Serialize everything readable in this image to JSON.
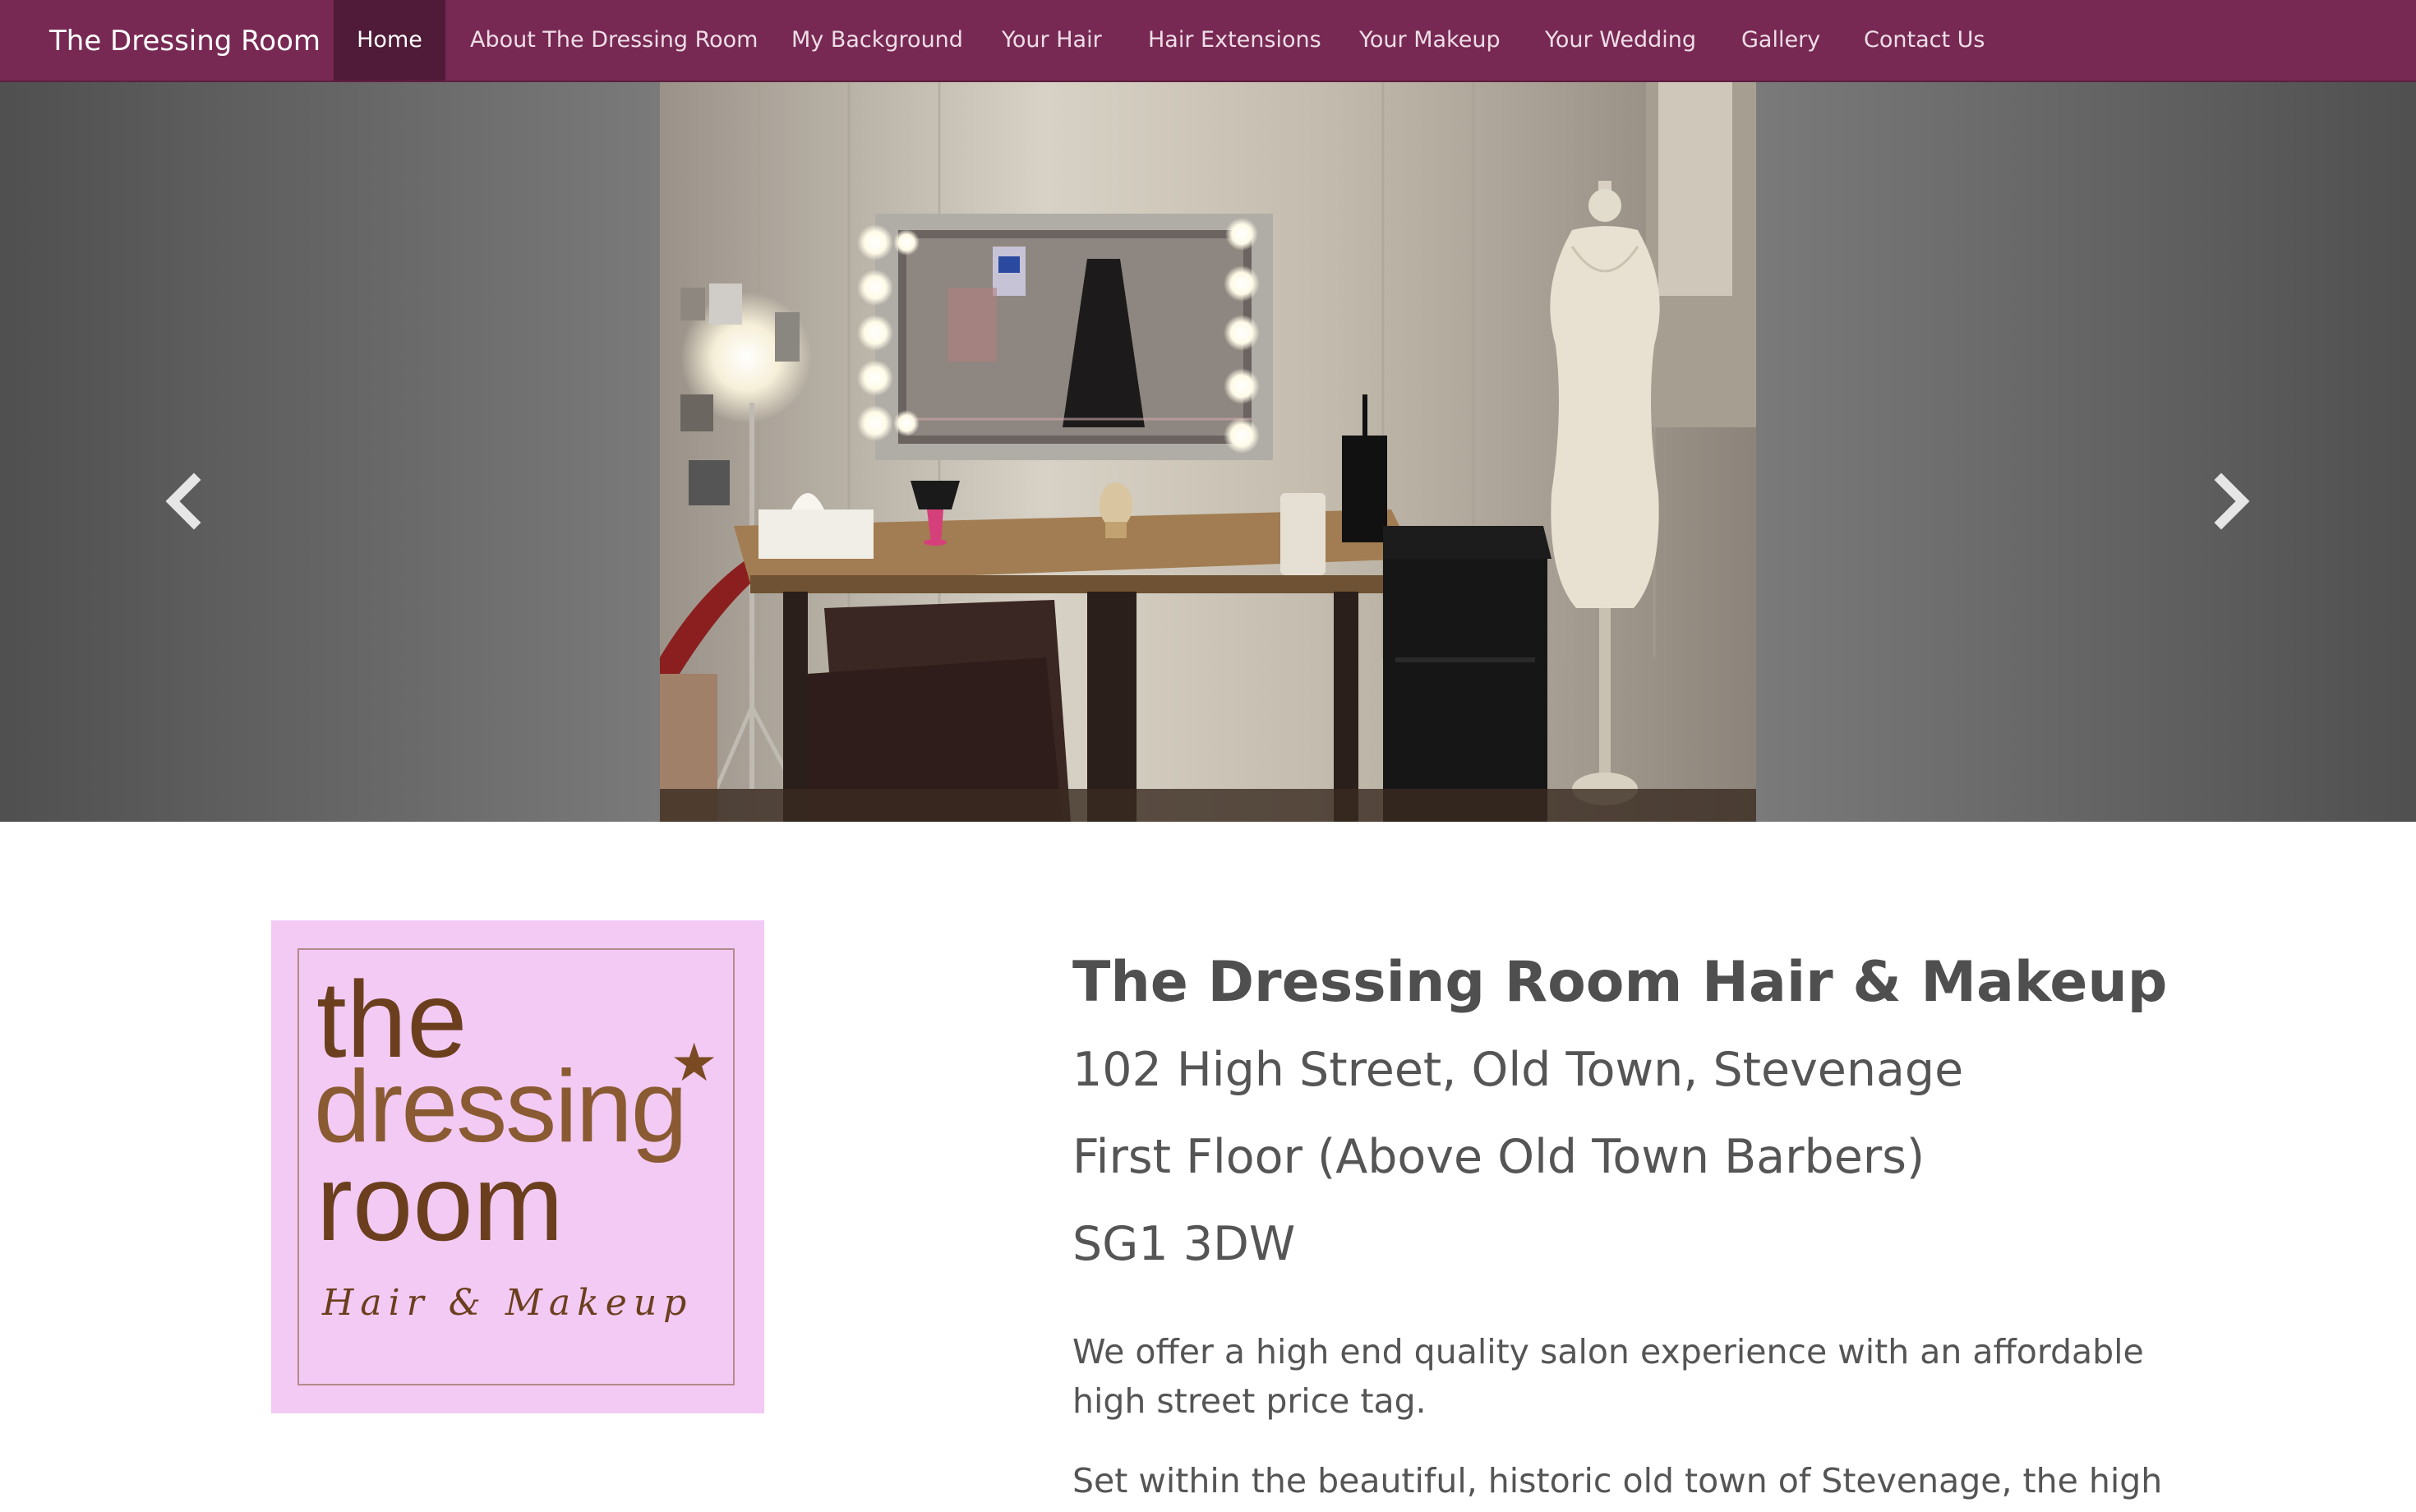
{
  "navbar": {
    "brand": "The Dressing Room",
    "items": [
      {
        "label": "Home",
        "active": true
      },
      {
        "label": "About The Dressing Room",
        "active": false
      },
      {
        "label": "My Background",
        "active": false
      },
      {
        "label": "Your Hair",
        "active": false
      },
      {
        "label": "Hair Extensions",
        "active": false
      },
      {
        "label": "Your Makeup",
        "active": false
      },
      {
        "label": "Your Wedding",
        "active": false
      },
      {
        "label": "Gallery",
        "active": false
      },
      {
        "label": "Contact Us",
        "active": false
      }
    ]
  },
  "carousel": {
    "slide_count": 8,
    "active_index": 0,
    "prev_icon": "chevron-left-icon",
    "next_icon": "chevron-right-icon"
  },
  "logo": {
    "line1": "the",
    "line2": "dressing",
    "line3": "room",
    "tagline": "Hair & Makeup",
    "star_icon": "star-icon"
  },
  "main": {
    "title": "The Dressing Room Hair & Makeup",
    "address_line1": "102 High Street, Old Town, Stevenage",
    "address_line2": "First Floor (Above Old Town Barbers)",
    "postcode": "SG1 3DW",
    "paragraph1": "We offer a high end quality salon experience with an affordable high street price tag.",
    "paragraph2": "Set within the beautiful, historic old town of Stevenage, the high"
  },
  "colors": {
    "navbar_bg": "#772953",
    "navbar_active_bg": "#4f1b38",
    "logo_bg": "#f2caf4",
    "logo_text": "#6b3f1e",
    "text": "#555555"
  }
}
